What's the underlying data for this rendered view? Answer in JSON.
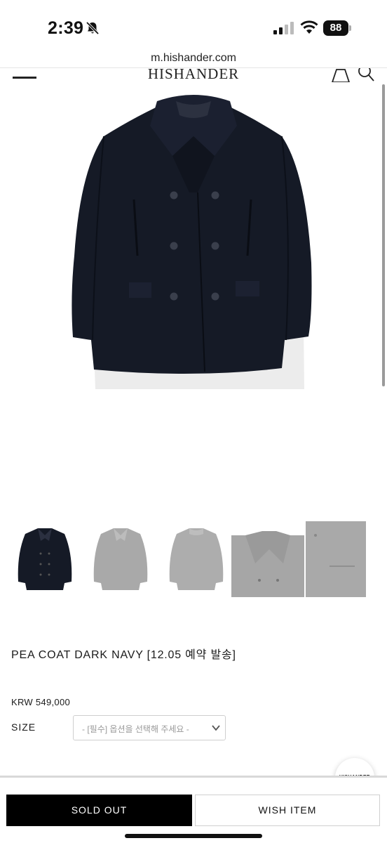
{
  "status_bar": {
    "time": "2:39",
    "battery": "88",
    "icons": [
      "bell-slash-icon",
      "signal-icon",
      "wifi-icon",
      "battery-icon"
    ]
  },
  "browser": {
    "url": "m.hishander.com"
  },
  "header": {
    "brand": "HISHANDER",
    "icons": [
      "menu-icon",
      "shopping-bag-icon",
      "search-icon"
    ]
  },
  "product": {
    "title": "PEA COAT DARK NAVY [12.05 예약 발송]",
    "price": "KRW 549,000",
    "size_label": "SIZE",
    "size_placeholder": "- [필수] 옵션을 선택해 주세요 -",
    "coat_color": "#151a26"
  },
  "thumbnails": [
    "front-view",
    "front-view-grey",
    "back-view-grey",
    "detail-view-grey"
  ],
  "floating_badge": {
    "text": "HISHANDER"
  },
  "actions": {
    "sold_out": "SOLD OUT",
    "wish": "WISH ITEM"
  }
}
